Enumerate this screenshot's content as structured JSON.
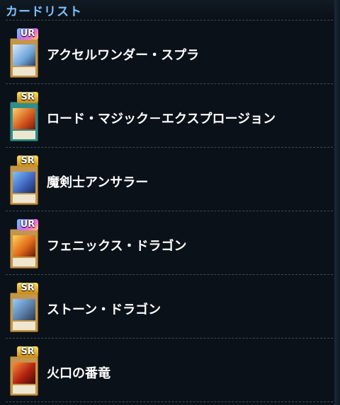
{
  "header": {
    "title": "カードリスト"
  },
  "cards": [
    {
      "rarity": "UR",
      "name": "アクセルワンダー・スプラ",
      "art": "ice"
    },
    {
      "rarity": "SR",
      "name": "ロード・マジック－エクスプロージョン",
      "art": "spell"
    },
    {
      "rarity": "SR",
      "name": "魔剣士アンサラー",
      "art": "blue"
    },
    {
      "rarity": "UR",
      "name": "フェニックス・ドラゴン",
      "art": "fire"
    },
    {
      "rarity": "SR",
      "name": "ストーン・ドラゴン",
      "art": "stone"
    },
    {
      "rarity": "SR",
      "name": "火口の番竜",
      "art": "ember"
    }
  ],
  "colors": {
    "title": "#7cc1ff",
    "background": "#0b1118",
    "divider": "#3b4b5a",
    "badge_sr": "#f2c23a",
    "badge_ur": "#b874ff"
  }
}
